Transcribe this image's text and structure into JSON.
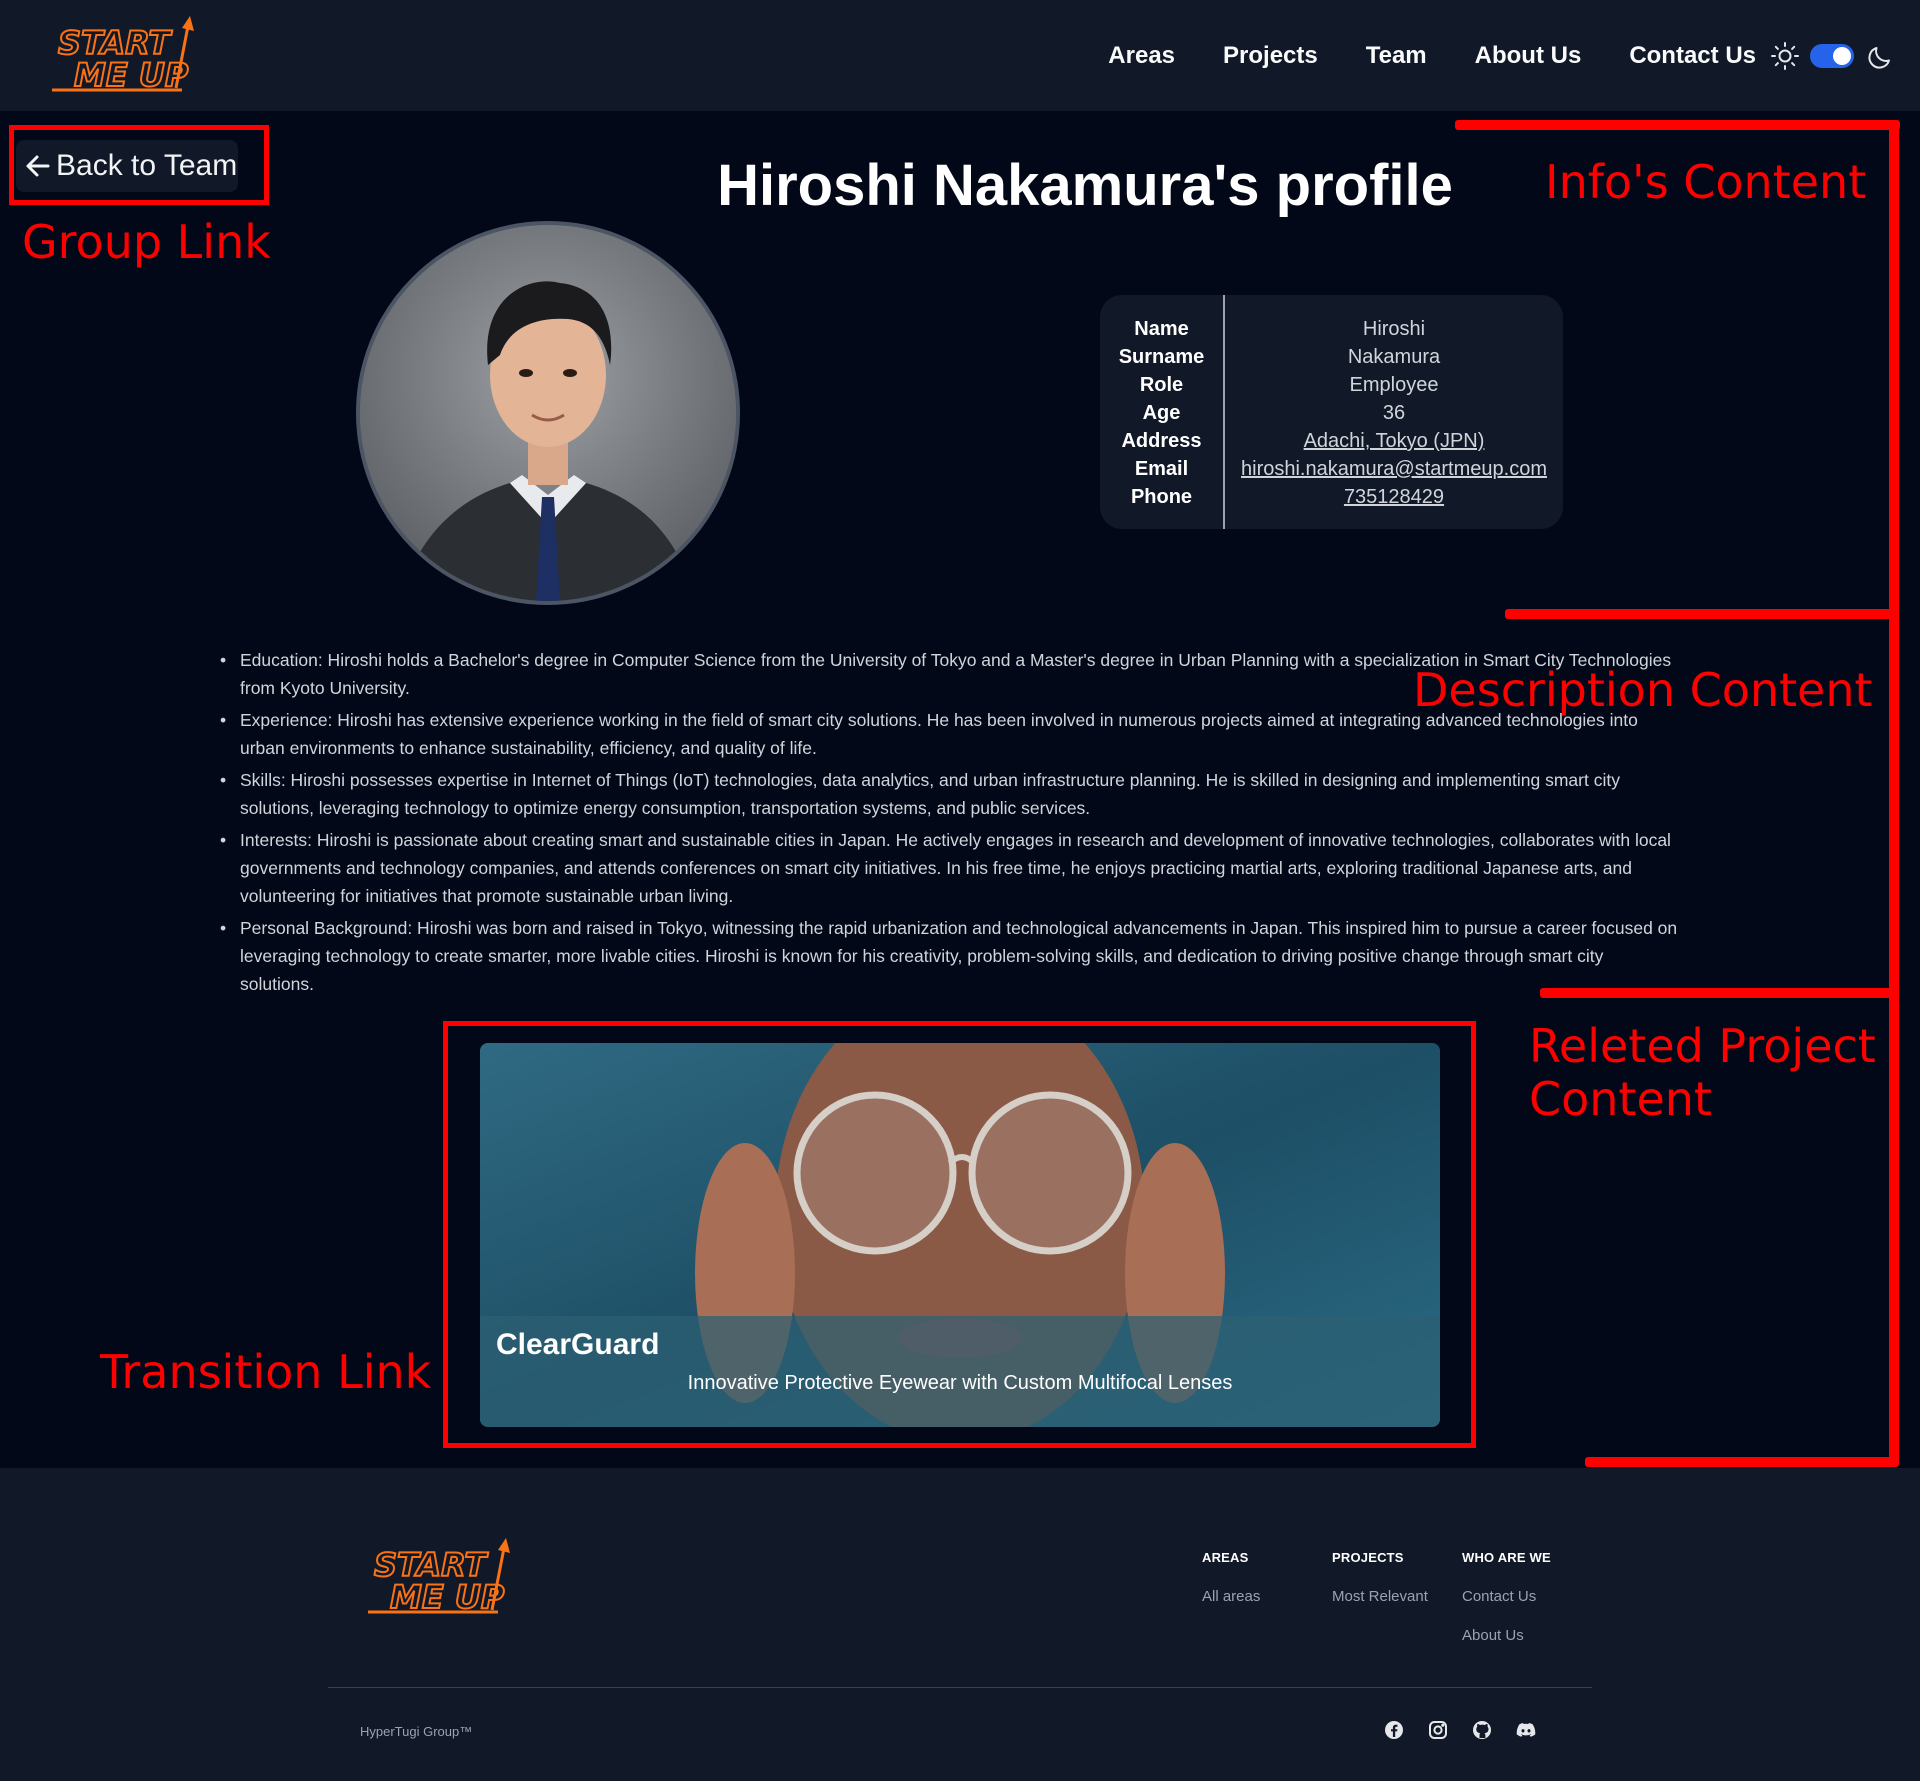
{
  "brand": {
    "logo_line1": "START",
    "logo_line2": "ME UP",
    "accent": "#f97316"
  },
  "nav": {
    "items": [
      {
        "label": "Areas"
      },
      {
        "label": "Projects"
      },
      {
        "label": "Team"
      },
      {
        "label": "About Us"
      },
      {
        "label": "Contact Us"
      }
    ],
    "theme": {
      "sun_icon": "sun-icon",
      "moon_icon": "moon-icon",
      "dark_mode": true,
      "toggle_color": "#2563eb"
    }
  },
  "back_link": {
    "icon": "arrow-left-icon",
    "label": "Back to Team"
  },
  "profile": {
    "title": "Hiroshi Nakamura's profile",
    "fields": [
      {
        "label": "Name",
        "value": "Hiroshi",
        "link": false
      },
      {
        "label": "Surname",
        "value": "Nakamura",
        "link": false
      },
      {
        "label": "Role",
        "value": "Employee",
        "link": false
      },
      {
        "label": "Age",
        "value": "36",
        "link": false
      },
      {
        "label": "Address",
        "value": "Adachi, Tokyo (JPN)",
        "link": true
      },
      {
        "label": "Email",
        "value": "hiroshi.nakamura@startmeup.com",
        "link": true
      },
      {
        "label": "Phone",
        "value": "735128429",
        "link": true
      }
    ]
  },
  "description": {
    "items": [
      "Education: Hiroshi holds a Bachelor's degree in Computer Science from the University of Tokyo and a Master's degree in Urban Planning with a specialization in Smart City Technologies from Kyoto University.",
      "Experience: Hiroshi has extensive experience working in the field of smart city solutions. He has been involved in numerous projects aimed at integrating advanced technologies into urban environments to enhance sustainability, efficiency, and quality of life.",
      "Skills: Hiroshi possesses expertise in Internet of Things (IoT) technologies, data analytics, and urban infrastructure planning. He is skilled in designing and implementing smart city solutions, leveraging technology to optimize energy consumption, transportation systems, and public services.",
      "Interests: Hiroshi is passionate about creating smart and sustainable cities in Japan. He actively engages in research and development of innovative technologies, collaborates with local governments and technology companies, and attends conferences on smart city initiatives. In his free time, he enjoys practicing martial arts, exploring traditional Japanese arts, and volunteering for initiatives that promote sustainable urban living.",
      "Personal Background: Hiroshi was born and raised in Tokyo, witnessing the rapid urbanization and technological advancements in Japan. This inspired him to pursue a career focused on leveraging technology to create smarter, more livable cities. Hiroshi is known for his creativity, problem-solving skills, and dedication to driving positive change through smart city solutions."
    ]
  },
  "project": {
    "name": "ClearGuard",
    "tagline": "Innovative Protective Eyewear with Custom Multifocal Lenses"
  },
  "annotations": {
    "color": "#ff0000",
    "group_link": "Group Link",
    "info_content": "Info's Content",
    "description_content": "Description Content",
    "related_project_line1": "Releted Project",
    "related_project_line2": "Content",
    "transition_link": "Transition Link"
  },
  "footer": {
    "columns": [
      {
        "heading": "AREAS",
        "links": [
          "All areas"
        ]
      },
      {
        "heading": "PROJECTS",
        "links": [
          "Most Relevant"
        ]
      },
      {
        "heading": "WHO ARE WE",
        "links": [
          "Contact Us",
          "About Us"
        ]
      }
    ],
    "copyright": "HyperTugi Group™",
    "socials": [
      "facebook-icon",
      "instagram-icon",
      "github-icon",
      "discord-icon"
    ]
  }
}
